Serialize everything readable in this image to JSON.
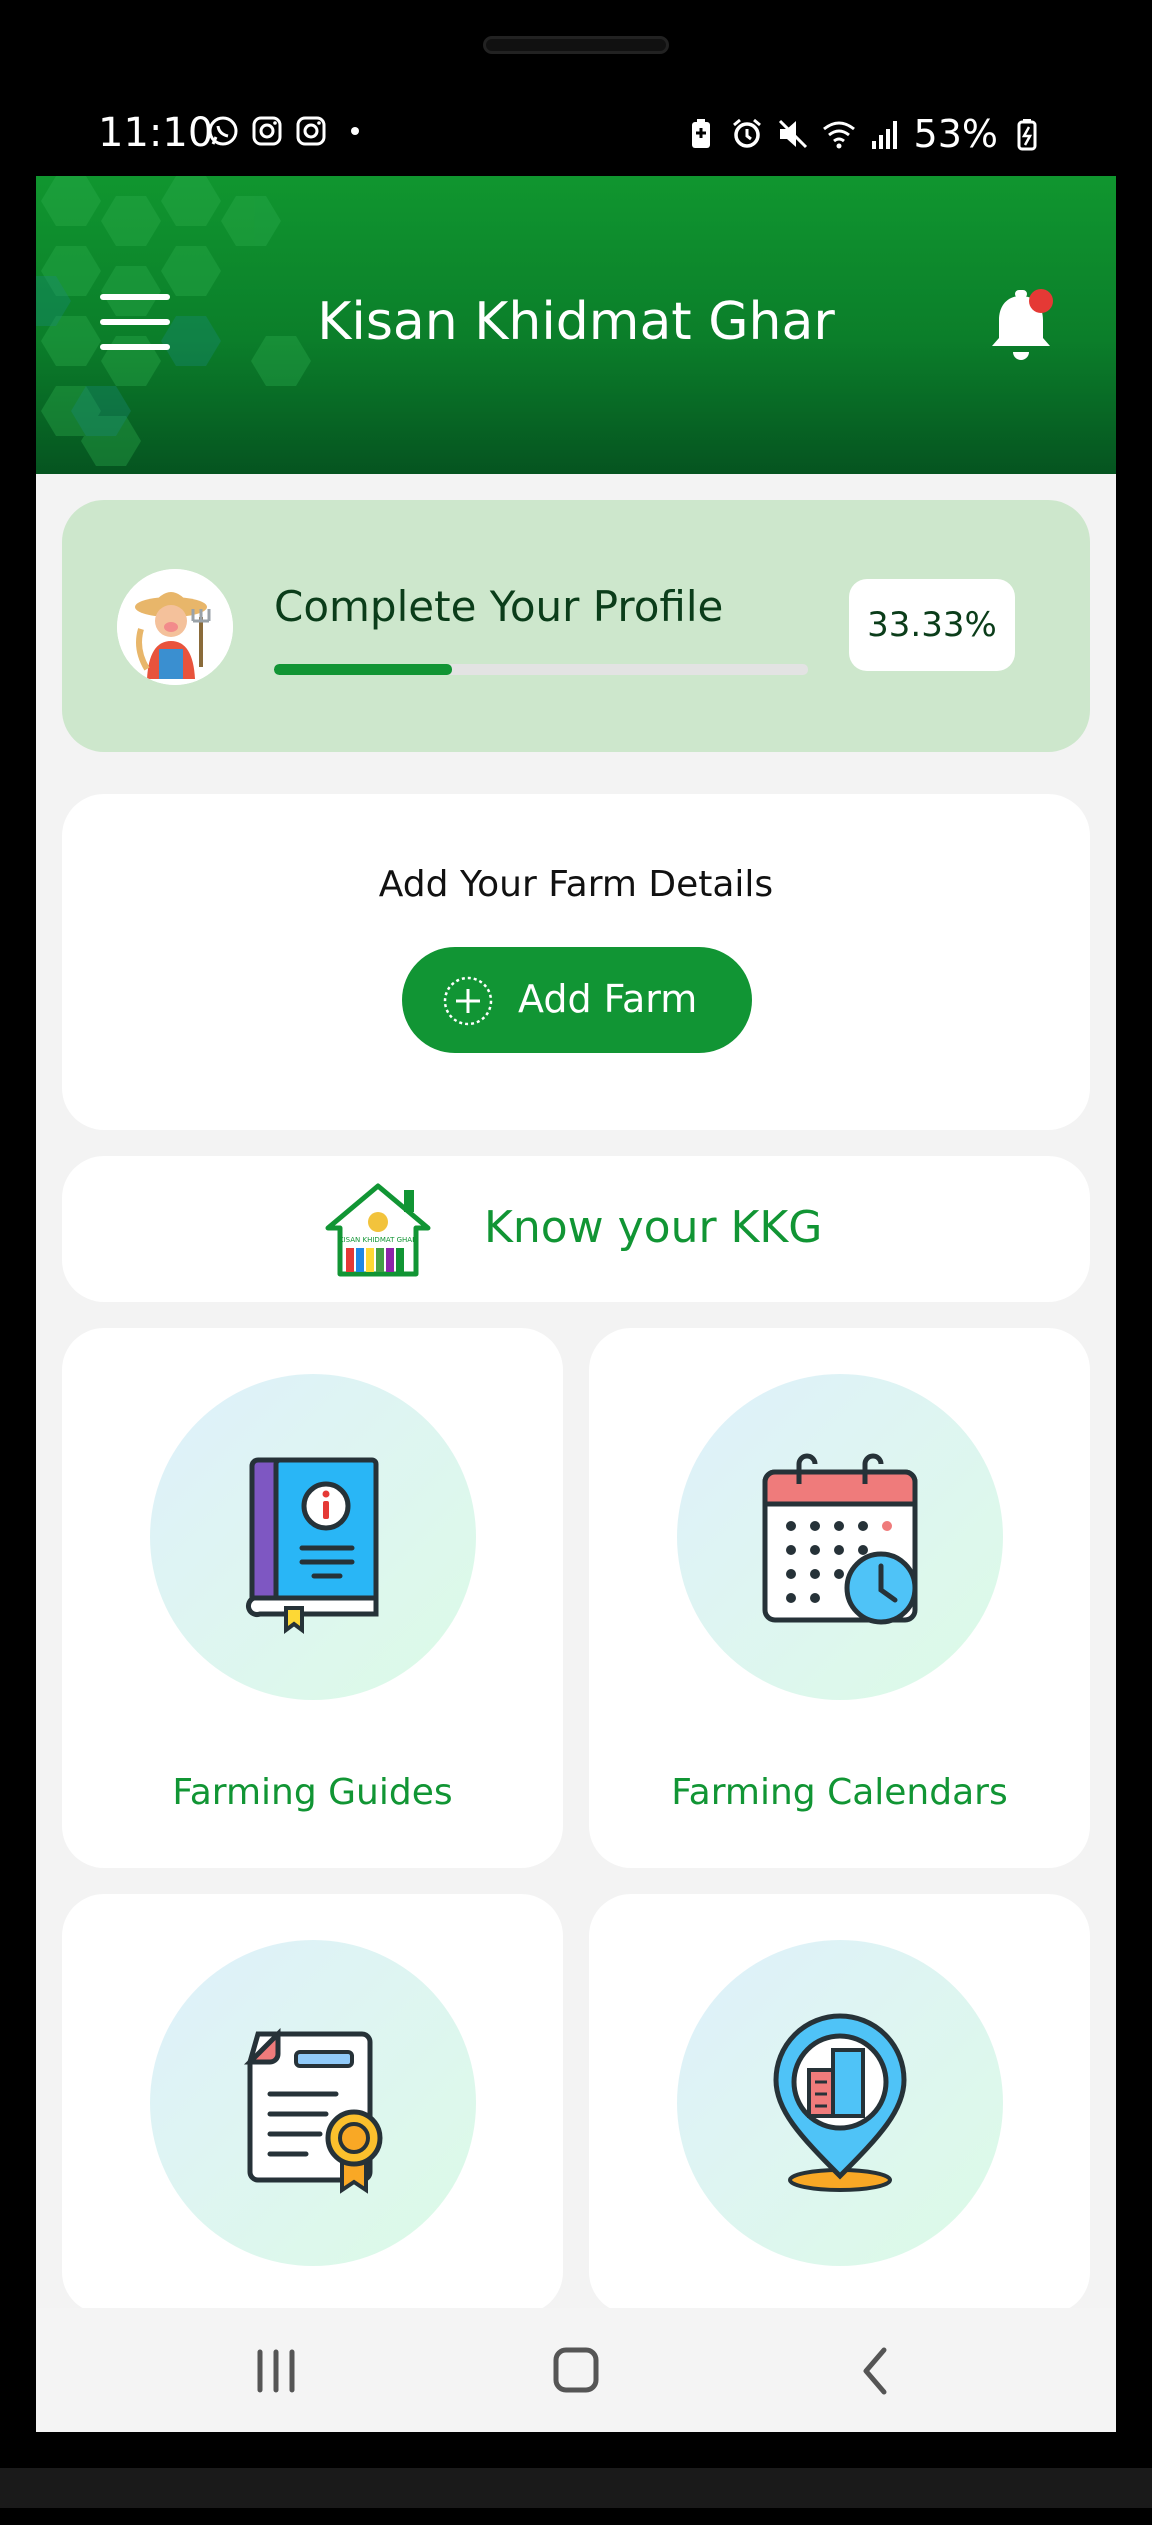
{
  "status_bar": {
    "time": "11:10",
    "battery": "53%",
    "left_icons": [
      "whatsapp-icon",
      "instagram-icon",
      "instagram-icon",
      "dot-icon"
    ],
    "right_icons": [
      "battery-saver-icon",
      "alarm-icon",
      "mute-icon",
      "wifi-icon",
      "signal-icon",
      "battery-icon"
    ]
  },
  "app_bar": {
    "title": "Kisan Khidmat Ghar",
    "menu_icon": "hamburger-menu-icon",
    "notification_icon": "bell-icon",
    "has_unread_notification": true,
    "brand_color": "#119534"
  },
  "profile_card": {
    "title": "Complete Your Profile",
    "progress_percent_text": "33.33%",
    "progress_value": 0.3333,
    "avatar": "farmer-avatar-icon"
  },
  "farm_card": {
    "title": "Add Your Farm Details",
    "button_label": "Add Farm",
    "button_icon": "plus-circle-icon"
  },
  "kkg_card": {
    "title": "Know your KKG",
    "logo": "kkg-house-logo"
  },
  "tiles": [
    {
      "label": "Farming Guides",
      "icon": "info-book-icon"
    },
    {
      "label": "Farming Calendars",
      "icon": "calendar-clock-icon"
    },
    {
      "label": "",
      "icon": "certificate-document-icon"
    },
    {
      "label": "",
      "icon": "location-building-icon"
    }
  ],
  "nav_bar": {
    "items": [
      "recent-apps-icon",
      "home-icon",
      "back-icon"
    ]
  }
}
